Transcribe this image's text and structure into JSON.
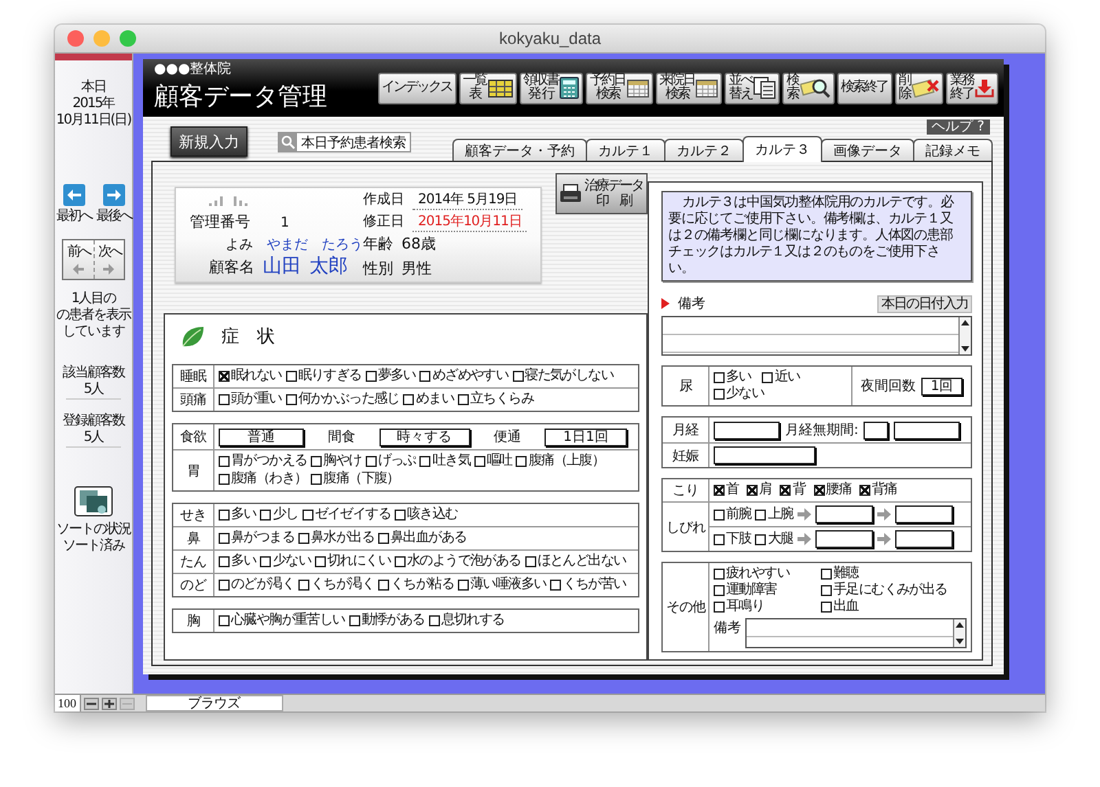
{
  "window": {
    "title": "kokyaku_data"
  },
  "sidebar": {
    "today_label": "本日",
    "year": "2015年",
    "date": "10月11日(日)",
    "nav_buttons": [
      {
        "label": "最初へ",
        "kind": "first"
      },
      {
        "label": "最後へ",
        "kind": "last"
      }
    ],
    "page_buttons": [
      {
        "label": "前へ",
        "kind": "prev"
      },
      {
        "label": "次へ",
        "kind": "next"
      }
    ],
    "record_status": [
      "1人目の",
      "の患者を表示",
      "しています"
    ],
    "counts": [
      {
        "label": "該当顧客数",
        "value": "5人"
      },
      {
        "label": "登録顧客数",
        "value": "5人"
      }
    ],
    "sort": {
      "label": "ソートの状況",
      "value": "ソート済み"
    }
  },
  "header": {
    "clinic": "●●●整体院",
    "title": "顧客データ管理",
    "toolbar": [
      {
        "label_lines": [
          "インデックス"
        ],
        "kind": "text"
      },
      {
        "label_lines": [
          "一覧",
          "表"
        ],
        "kind": "list"
      },
      {
        "label_lines": [
          "領収書",
          "発 行"
        ],
        "kind": "receipt"
      },
      {
        "label_lines": [
          "予約日",
          "検索"
        ],
        "kind": "calendar"
      },
      {
        "label_lines": [
          "来院日",
          "検索"
        ],
        "kind": "calendar"
      },
      {
        "label_lines": [
          "並べ",
          "替え"
        ],
        "kind": "sort"
      },
      {
        "label_lines": [
          "検",
          "索"
        ],
        "kind": "search"
      },
      {
        "label_lines": [
          "検索終了"
        ],
        "kind": "text"
      },
      {
        "label_lines": [
          "削",
          "除"
        ],
        "kind": "delete"
      },
      {
        "label_lines": [
          "業務",
          "終了"
        ],
        "kind": "exit"
      }
    ]
  },
  "topbar": {
    "new_button": "新規入力",
    "search_button": "本日予約患者検索",
    "help_button": "ヘルプ ?",
    "tabs": [
      {
        "label": "顧客データ・予約",
        "selected": false
      },
      {
        "label": "カルテ１",
        "selected": false
      },
      {
        "label": "カルテ２",
        "selected": false
      },
      {
        "label": "カルテ３",
        "selected": true
      },
      {
        "label": "画像データ",
        "selected": false
      },
      {
        "label": "記録メモ",
        "selected": false
      }
    ]
  },
  "patient": {
    "number": {
      "label": "管理番号",
      "value": "1"
    },
    "created": {
      "label": "作成日",
      "value": "2014年 5月19日"
    },
    "modified": {
      "label": "修正日",
      "value": "2015年10月11日"
    },
    "reading": {
      "label": "よみ",
      "family": "やまだ",
      "given": "たろう"
    },
    "name": {
      "label": "顧客名",
      "family": "山田",
      "given": "太郎"
    },
    "age": {
      "label": "年齢",
      "value": "68歳"
    },
    "sex": {
      "label": "性別",
      "value": "男性"
    },
    "print_button": [
      "治療データ",
      "印　刷"
    ]
  },
  "symptoms": {
    "title": "症　状",
    "groups": [
      {
        "rows": [
          {
            "label": "睡眠",
            "kind": "checks",
            "options": [
              {
                "label": "眠れない",
                "checked": true
              },
              {
                "label": "眠りすぎる",
                "checked": false
              },
              {
                "label": "夢多い",
                "checked": false
              },
              {
                "label": "めざめやすい",
                "checked": false
              },
              {
                "label": "寝た気がしない",
                "checked": false
              }
            ]
          },
          {
            "label": "頭痛",
            "kind": "checks",
            "options": [
              {
                "label": "頭が重い",
                "checked": false
              },
              {
                "label": "何かかぶった感じ",
                "checked": false
              },
              {
                "label": "めまい",
                "checked": false
              },
              {
                "label": "立ちくらみ",
                "checked": false
              }
            ]
          }
        ]
      },
      {
        "rows": [
          {
            "label": "食欲",
            "kind": "fields",
            "fields": [
              {
                "value": "普通"
              },
              {
                "label": "間食",
                "value": "時々する"
              },
              {
                "label": "便通",
                "value": "1日1回"
              }
            ]
          },
          {
            "label": "胃",
            "kind": "checks",
            "options": [
              {
                "label": "胃がつかえる",
                "checked": false
              },
              {
                "label": "胸やけ",
                "checked": false
              },
              {
                "label": "げっぷ",
                "checked": false
              },
              {
                "label": "吐き気",
                "checked": false
              },
              {
                "label": "嘔吐",
                "checked": false
              },
              {
                "label": "腹痛（上腹）",
                "checked": false
              },
              {
                "label": "腹痛（わき）",
                "checked": false
              },
              {
                "label": "腹痛（下腹）",
                "checked": false
              }
            ]
          }
        ]
      },
      {
        "rows": [
          {
            "label": "せき",
            "kind": "checks",
            "options": [
              {
                "label": "多い",
                "checked": false
              },
              {
                "label": "少し",
                "checked": false
              },
              {
                "label": "ゼイゼイする",
                "checked": false
              },
              {
                "label": "咳き込む",
                "checked": false
              }
            ]
          },
          {
            "label": "鼻",
            "kind": "checks",
            "options": [
              {
                "label": "鼻がつまる",
                "checked": false
              },
              {
                "label": "鼻水が出る",
                "checked": false
              },
              {
                "label": "鼻出血がある",
                "checked": false
              }
            ]
          },
          {
            "label": "たん",
            "kind": "checks",
            "options": [
              {
                "label": "多い",
                "checked": false
              },
              {
                "label": "少ない",
                "checked": false
              },
              {
                "label": "切れにくい",
                "checked": false
              },
              {
                "label": "水のようで泡がある",
                "checked": false
              },
              {
                "label": "ほとんど出ない",
                "checked": false
              }
            ]
          },
          {
            "label": "のど",
            "kind": "checks",
            "options": [
              {
                "label": "のどが渇く",
                "checked": false
              },
              {
                "label": "くちが渇く",
                "checked": false
              },
              {
                "label": "くちが粘る",
                "checked": false
              },
              {
                "label": "薄い唾液多い",
                "checked": false
              },
              {
                "label": "くちが苦い",
                "checked": false
              }
            ]
          }
        ]
      },
      {
        "rows": [
          {
            "label": "胸",
            "kind": "checks",
            "options": [
              {
                "label": "心臓や胸が重苦しい",
                "checked": false
              },
              {
                "label": "動悸がある",
                "checked": false
              },
              {
                "label": "息切れする",
                "checked": false
              }
            ]
          }
        ]
      }
    ]
  },
  "notes_panel": {
    "notice": "カルテ３は中国気功整体院用のカルテです。必要に応じてご使用下さい。備考欄は、カルテ１又は２の備考欄と同じ欄になります。人体図の患部チェックはカルテ１又は２のものをご使用下さい。",
    "remarks_label": "備考",
    "date_button": "本日の日付入力",
    "urine": {
      "label": "尿",
      "options": [
        {
          "label": "多い",
          "checked": false
        },
        {
          "label": "近い",
          "checked": false
        },
        {
          "label": "少ない",
          "checked": false
        }
      ],
      "night_label": "夜間回数",
      "night_value": "1回"
    },
    "menses": {
      "label": "月経",
      "absent_label": "月経無期間:"
    },
    "pregnancy": {
      "label": "妊娠"
    },
    "stiffness": {
      "label": "こり",
      "options": [
        {
          "label": "首",
          "checked": true
        },
        {
          "label": "肩",
          "checked": true
        },
        {
          "label": "背",
          "checked": true
        },
        {
          "label": "腰痛",
          "checked": true
        },
        {
          "label": "背痛",
          "checked": true
        }
      ]
    },
    "numbness": {
      "label": "しびれ",
      "rows": [
        {
          "options": [
            {
              "label": "前腕",
              "checked": false
            },
            {
              "label": "上腕",
              "checked": false
            }
          ]
        },
        {
          "options": [
            {
              "label": "下肢",
              "checked": false
            },
            {
              "label": "大腿",
              "checked": false
            }
          ]
        }
      ]
    },
    "other": {
      "label": "その他",
      "options": [
        {
          "label": "疲れやすい",
          "checked": false
        },
        {
          "label": "難聴",
          "checked": false
        },
        {
          "label": "運動障害",
          "checked": false
        },
        {
          "label": "手足にむくみが出る",
          "checked": false
        },
        {
          "label": "耳鳴り",
          "checked": false
        },
        {
          "label": "出血",
          "checked": false
        }
      ],
      "remarks_label": "備考"
    }
  },
  "status_bar": {
    "zoom": "100",
    "mode": "ブラウズ"
  }
}
